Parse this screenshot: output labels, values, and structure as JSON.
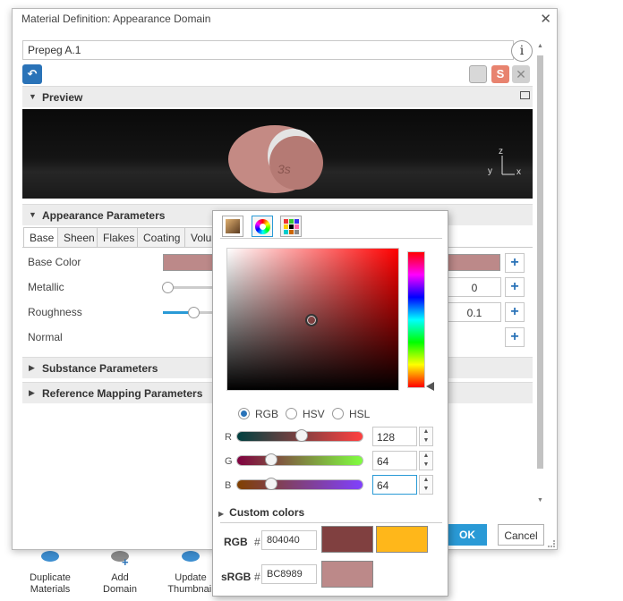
{
  "dialog": {
    "title": "Material Definition: Appearance Domain",
    "name_value": "Prepeg A.1",
    "sections": {
      "preview": "Preview",
      "appearance": "Appearance Parameters",
      "substance": "Substance Parameters",
      "reference": "Reference Mapping Parameters"
    },
    "tabs": [
      "Base",
      "Sheen",
      "Flakes",
      "Coating",
      "Volu"
    ],
    "params": {
      "base_color": "Base Color",
      "metallic": "Metallic",
      "metallic_value": "0",
      "roughness": "Roughness",
      "roughness_value": "0.1",
      "normal": "Normal"
    },
    "ok_label": "OK",
    "cancel_label": "Cancel",
    "colors": {
      "base_color": "#BC8989",
      "accent": "#2a9ad6"
    }
  },
  "ribbon": {
    "items": [
      {
        "label_line1": "Duplicate",
        "label_line2": "Materials"
      },
      {
        "label_line1": "Add",
        "label_line2": "Domain"
      },
      {
        "label_line1": "Update",
        "label_line2": "Thumbnail"
      }
    ]
  },
  "picker": {
    "modes": [
      "RGB",
      "HSV",
      "HSL"
    ],
    "selected_mode": "RGB",
    "channels": [
      {
        "label": "R",
        "value": "128"
      },
      {
        "label": "G",
        "value": "64"
      },
      {
        "label": "B",
        "value": "64"
      }
    ],
    "custom_colors_label": "Custom colors",
    "rgb_label": "RGB",
    "srgb_label": "sRGB",
    "hash": "#",
    "rgb_hex": "804040",
    "srgb_hex": "BC8989",
    "colors": {
      "rgb_swatch": "#804040",
      "custom_swatch": "#FFB71A",
      "srgb_swatch": "#BC8989"
    }
  },
  "axis_labels": {
    "z": "z",
    "y": "y",
    "x": "x"
  }
}
